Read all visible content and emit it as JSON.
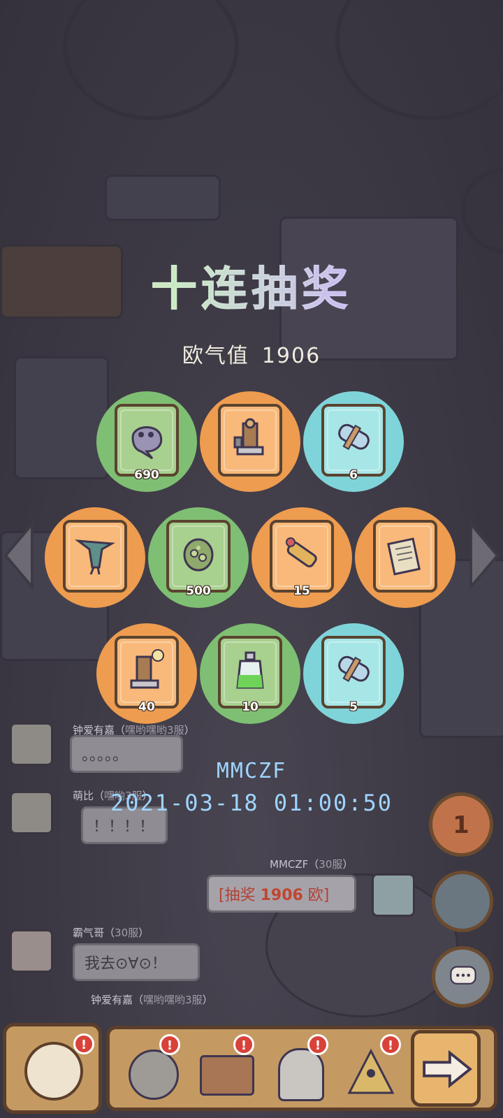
{
  "title": "十连抽奖",
  "luck": {
    "label": "欧气值",
    "value": "1906"
  },
  "items": [
    {
      "name": "gem-blob",
      "count": "690",
      "color": "green"
    },
    {
      "name": "machine",
      "count": "",
      "color": "orange"
    },
    {
      "name": "scroll",
      "count": "6",
      "color": "cyan"
    },
    {
      "name": "artifact",
      "count": "",
      "color": "orange"
    },
    {
      "name": "shell-egg",
      "count": "500",
      "color": "green"
    },
    {
      "name": "telescope",
      "count": "15",
      "color": "orange"
    },
    {
      "name": "papers",
      "count": "",
      "color": "orange"
    },
    {
      "name": "machine-upgrade",
      "count": "40",
      "color": "orange"
    },
    {
      "name": "potion",
      "count": "10",
      "color": "green"
    },
    {
      "name": "scroll",
      "count": "5",
      "color": "cyan"
    }
  ],
  "result": {
    "player": "MMCZF",
    "timestamp": "2021-03-18 01:00:50"
  },
  "chat": [
    {
      "name": "钟爱有嘉",
      "server": "嘿哟嘿哟3服",
      "text": "。。。。。"
    },
    {
      "name": "萌比",
      "server": "嘿哟3服",
      "text": "！！！！"
    },
    {
      "name": "MMCZF",
      "server": "30服",
      "text_prefix": "[抽奖 ",
      "highlight": "1906",
      "text_suffix": " 欧]"
    },
    {
      "name": "霸气哥",
      "server": "30服",
      "text": "我去⊙∀⊙！"
    },
    {
      "name": "钟爱有嘉",
      "server": "嘿哟嘿哟3服",
      "text": ""
    }
  ],
  "side": {
    "counter": "1"
  },
  "icons": {
    "left_arrow": "chevron-left-icon",
    "right_arrow": "chevron-right-icon",
    "next": "arrow-right-icon",
    "chat": "chat-icon"
  },
  "colors": {
    "green": "#7fbf73",
    "orange": "#ee9c4f",
    "cyan": "#7fd4d9"
  }
}
